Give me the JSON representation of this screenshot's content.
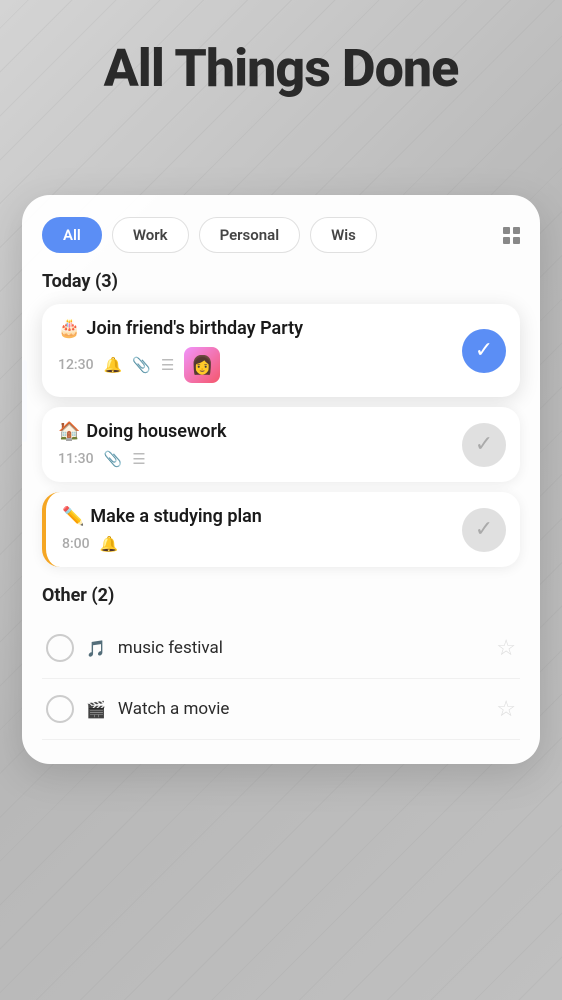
{
  "app": {
    "title": "All Things Done"
  },
  "filters": {
    "tabs": [
      {
        "label": "All",
        "active": true
      },
      {
        "label": "Work",
        "active": false
      },
      {
        "label": "Personal",
        "active": false
      },
      {
        "label": "Wis",
        "active": false
      }
    ]
  },
  "today_section": {
    "header": "Today (3)",
    "tasks": [
      {
        "emoji": "🎂",
        "title": "Join friend's birthday Party",
        "time": "12:30",
        "has_bell": true,
        "has_clip": true,
        "has_list": true,
        "has_thumbnail": true,
        "thumbnail_emoji": "👩",
        "completed": true
      },
      {
        "emoji": "🏠",
        "title": "Doing housework",
        "time": "11:30",
        "has_bell": false,
        "has_clip": true,
        "has_list": true,
        "has_thumbnail": false,
        "completed": false
      },
      {
        "emoji": "✏️",
        "title": "Make a studying plan",
        "time": "8:00",
        "has_bell": true,
        "has_clip": false,
        "has_list": false,
        "has_thumbnail": false,
        "completed": false,
        "yellow_accent": true
      }
    ]
  },
  "other_section": {
    "header": "Other (2)",
    "tasks": [
      {
        "emoji": "🎵",
        "title": "music festival",
        "starred": false
      },
      {
        "emoji": "🎬",
        "title": "Watch a movie",
        "starred": false
      }
    ]
  }
}
